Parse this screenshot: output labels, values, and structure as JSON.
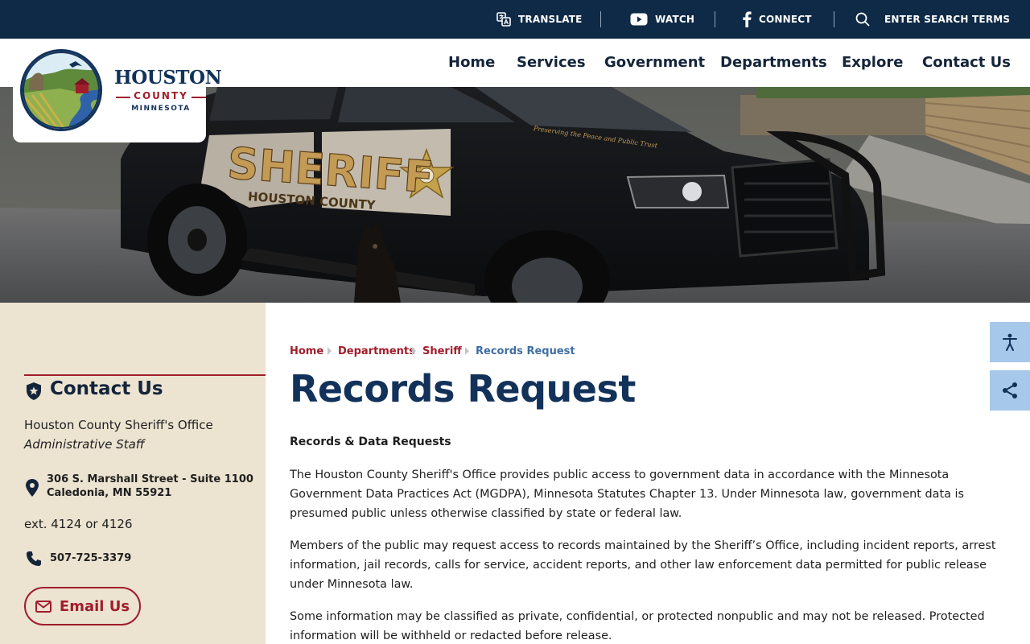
{
  "utility_bar": {
    "translate": "TRANSLATE",
    "watch": "WATCH",
    "connect": "CONNECT",
    "search": "ENTER SEARCH TERMS"
  },
  "logo": {
    "title": "HOUSTON",
    "county": "COUNTY",
    "state": "MINNESOTA"
  },
  "nav": {
    "items": [
      "Home",
      "Services",
      "Government",
      "Departments",
      "Explore",
      "Contact Us"
    ]
  },
  "hero": {
    "vehicle_text": "SHERIFF",
    "vehicle_subtext": "HOUSTON COUNTY",
    "vehicle_motto": "Preserving the Peace and Public Trust"
  },
  "sidebar": {
    "heading": "Contact Us",
    "office": "Houston County Sheriff's Office",
    "staff": "Administrative Staff",
    "address_line1": "306 S. Marshall Street - Suite 1100",
    "address_line2": "Caledonia, MN 55921",
    "ext": "ext. 4124 or 4126",
    "phone": "507-725-3379",
    "email_label": "Email Us"
  },
  "breadcrumb": {
    "items": [
      "Home",
      "Departments",
      "Sheriff",
      "Records Request"
    ]
  },
  "content": {
    "title": "Records Request",
    "subheading": "Records & Data Requests",
    "paragraphs": [
      "The Houston County Sheriff's Office provides public access to government data in accordance with the Minnesota Government Data Practices Act (MGDPA), Minnesota Statutes Chapter 13. Under Minnesota law, government data is presumed public unless otherwise classified by state or federal law.",
      "Members of the public may request access to records maintained by the Sheriff’s Office, including incident reports, arrest information, jail records, calls for service, accident reports, and other law enforcement data permitted for public release under Minnesota law.",
      "Some information may be classified as private, confidential, or protected nonpublic and may not be released. Protected information will be withheld or redacted before release."
    ]
  },
  "colors": {
    "navy": "#0f2a47",
    "crimson": "#a11d2c",
    "sidebar_bg": "#ece3d1",
    "widget_blue": "#a6c8ea"
  },
  "icons": [
    "translate-icon",
    "youtube-icon",
    "facebook-icon",
    "search-icon",
    "shield-star-icon",
    "map-pin-icon",
    "phone-icon",
    "mail-icon",
    "accessibility-icon",
    "share-icon"
  ]
}
